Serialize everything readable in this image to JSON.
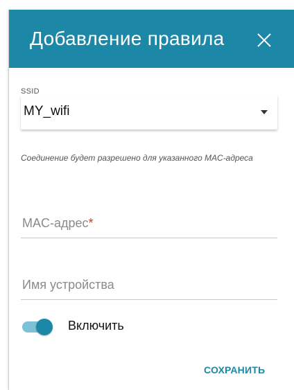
{
  "dialog": {
    "title": "Добавление правила",
    "close_icon": "close-icon"
  },
  "ssid": {
    "label": "SSID",
    "value": "MY_wifi",
    "dropdown_icon": "chevron-down-icon"
  },
  "hint": "Соединение будет разрешено для указанного MAC-адреса",
  "mac_field": {
    "placeholder": "MAC-адрес",
    "required_mark": "*"
  },
  "name_field": {
    "placeholder": "Имя устройства"
  },
  "enable_toggle": {
    "label": "Включить",
    "on": true
  },
  "actions": {
    "save_label": "СОХРАНИТЬ"
  },
  "colors": {
    "accent": "#1c87a6",
    "required": "#e0301e"
  }
}
